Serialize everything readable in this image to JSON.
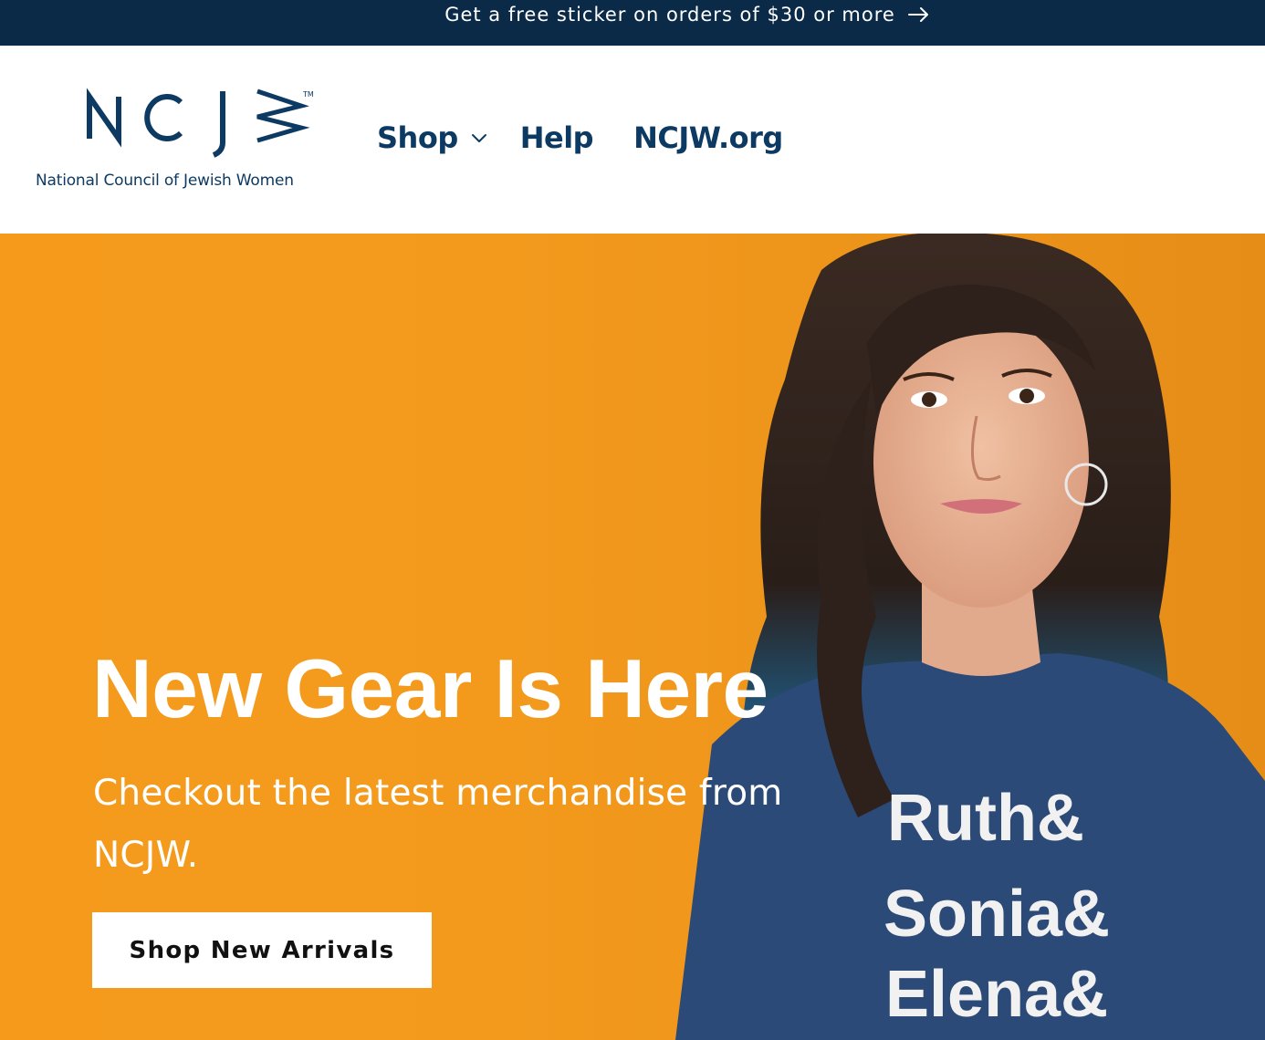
{
  "announcement": {
    "text": "Get a free sticker on orders of $30 or more",
    "icon": "arrow-right-icon",
    "bg_color": "#0a2a47"
  },
  "header": {
    "logo": {
      "mark_text": "NCJW",
      "trademark": "TM",
      "tagline": "National Council of Jewish Women",
      "brand_color": "#0d3a63"
    },
    "nav": [
      {
        "label": "Shop",
        "icon": "chevron-down-icon"
      },
      {
        "label": "Help"
      },
      {
        "label": "NCJW.org"
      }
    ]
  },
  "hero": {
    "title": "New Gear Is Here",
    "subtitle": "Checkout the latest merchandise from NCJW.",
    "button_label": "Shop New Arrivals",
    "bg_color": "#f59a1b",
    "shirt_text": [
      "Ruth&",
      "Sonia&",
      "Elena&"
    ]
  }
}
